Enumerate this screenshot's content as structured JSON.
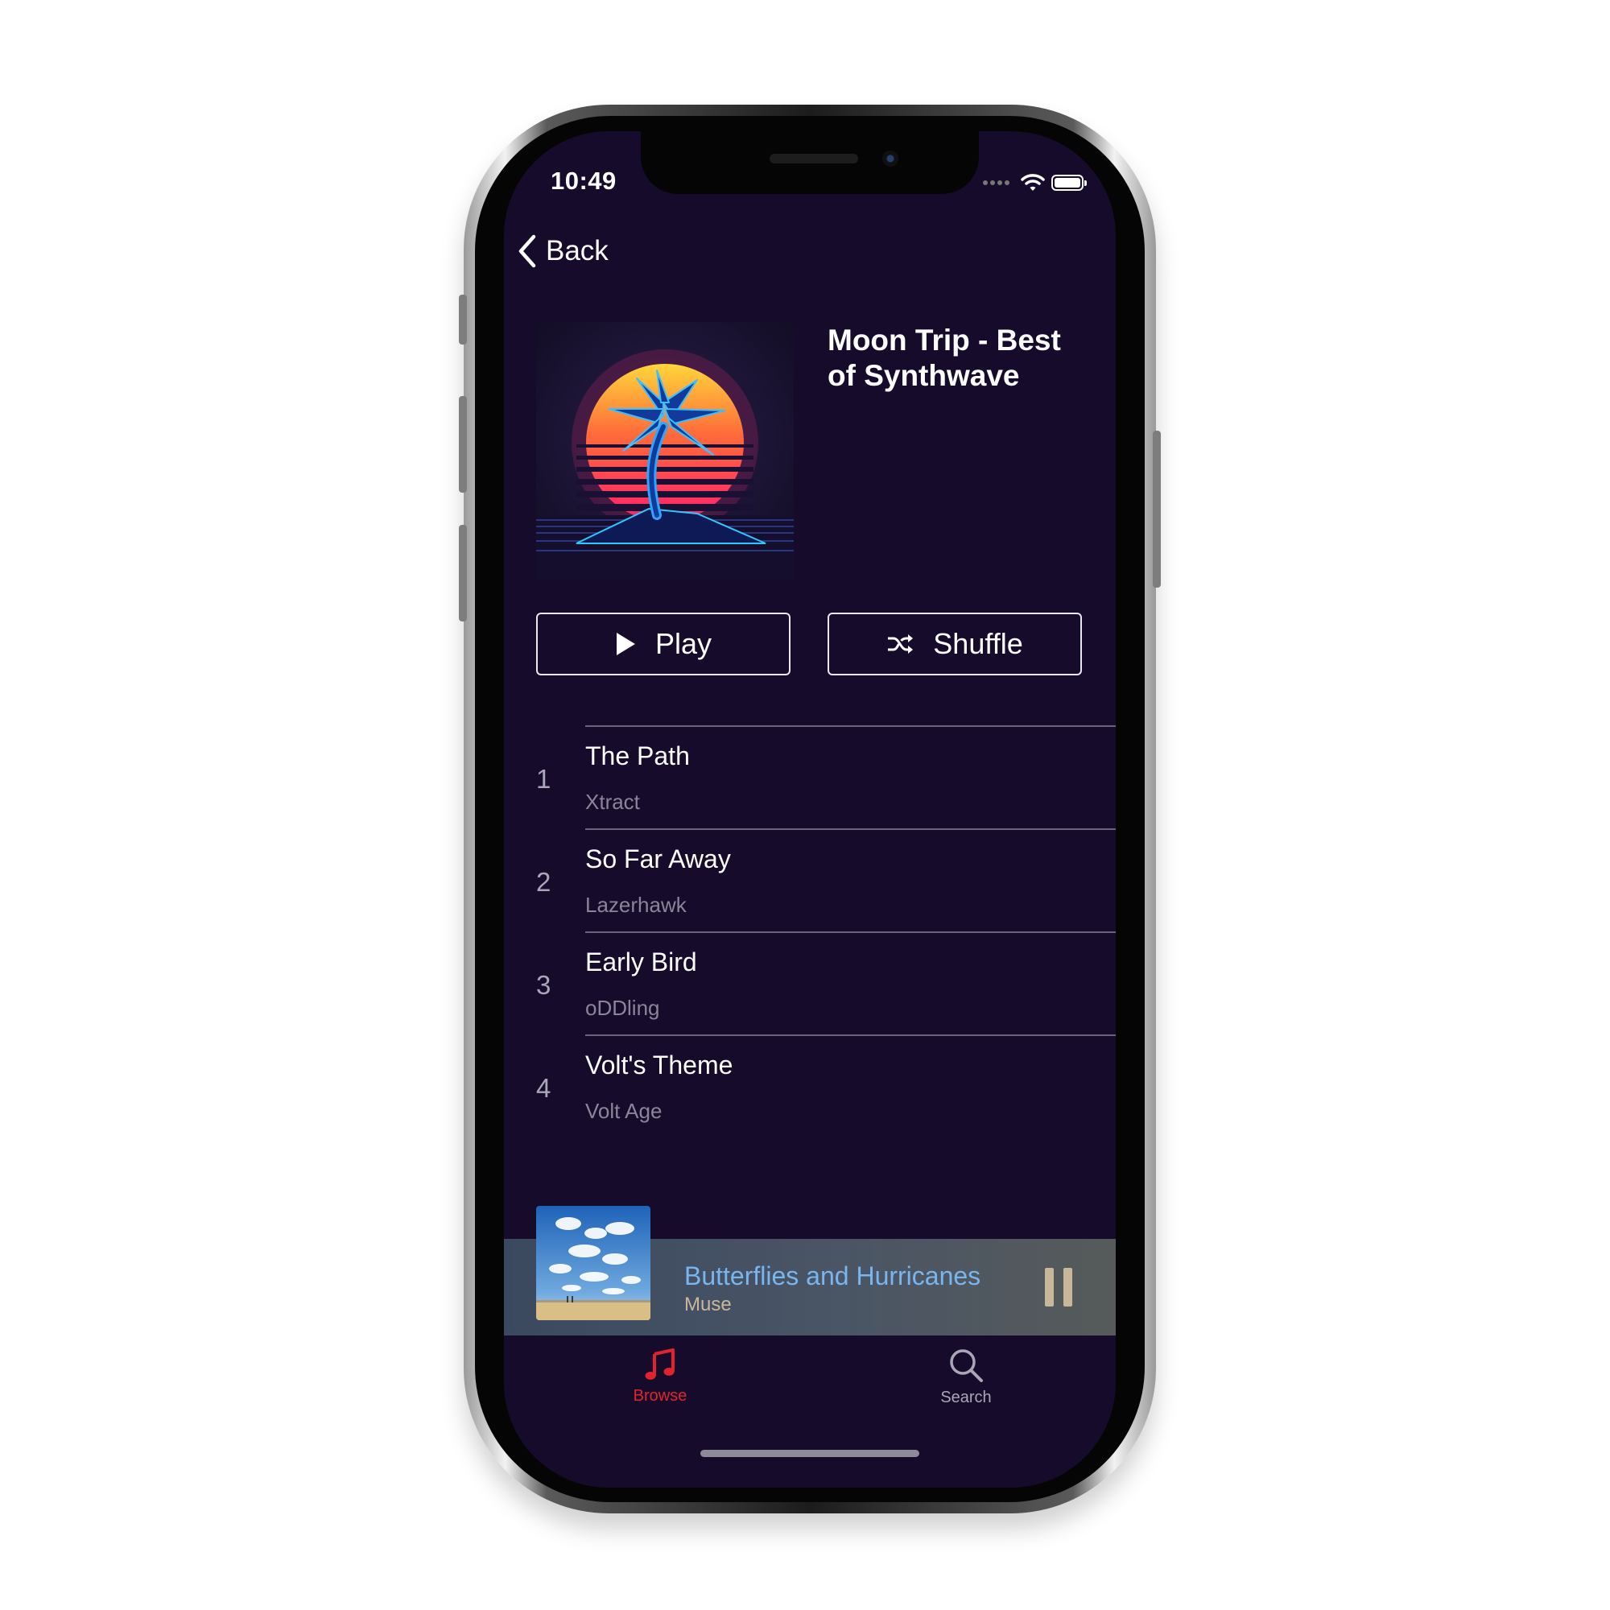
{
  "status_bar": {
    "time": "10:49"
  },
  "navigation": {
    "back_label": "Back"
  },
  "album": {
    "title": "Moon Trip - Best of Synthwave"
  },
  "actions": {
    "play_label": "Play",
    "shuffle_label": "Shuffle"
  },
  "tracks": [
    {
      "number": "1",
      "title": "The Path",
      "artist": "Xtract"
    },
    {
      "number": "2",
      "title": "So Far Away",
      "artist": "Lazerhawk"
    },
    {
      "number": "3",
      "title": "Early Bird",
      "artist": "oDDling"
    },
    {
      "number": "4",
      "title": "Volt's Theme",
      "artist": "Volt Age"
    }
  ],
  "now_playing": {
    "title": "Butterflies and Hurricanes",
    "artist": "Muse"
  },
  "tab_bar": {
    "items": [
      {
        "label": "Browse",
        "icon": "music-note-icon",
        "active": true
      },
      {
        "label": "Search",
        "icon": "search-icon",
        "active": false
      }
    ]
  },
  "colors": {
    "background": "#170b2b",
    "accent": "#e0242e",
    "now_playing_title": "#79b6ee",
    "now_playing_artist": "#c9b79b",
    "secondary_text": "#8a8599"
  }
}
